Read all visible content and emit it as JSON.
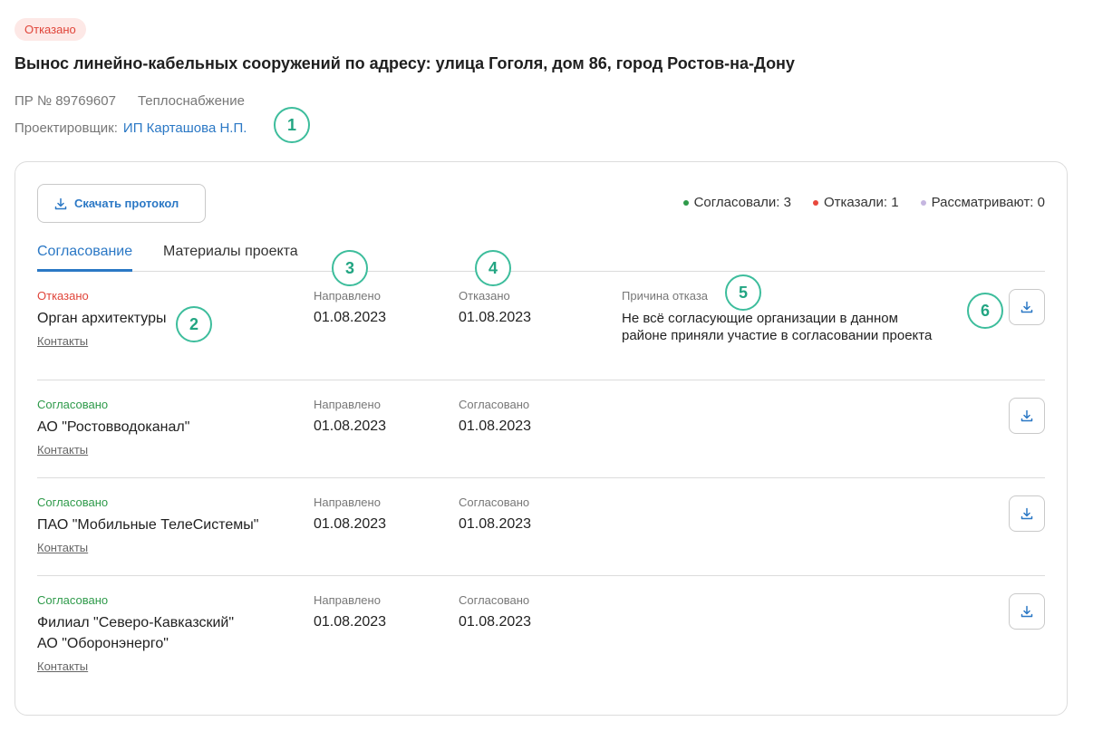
{
  "header": {
    "status_label": "Отказано",
    "title": "Вынос линейно-кабельных сооружений по адресу: улица Гоголя, дом 86, город Ростов-на-Дону",
    "request_number": "ПР № 89769607",
    "category": "Теплоснабжение",
    "designer_label": "Проектировщик:",
    "designer_name": "ИП Карташова Н.П."
  },
  "toolbar": {
    "download_protocol_label": "Скачать протокол",
    "download_icon": "download-icon"
  },
  "summary": {
    "approved": "Согласовали: 3",
    "rejected": "Отказали: 1",
    "reviewing": "Рассматривают: 0",
    "colors": {
      "approved": "#2e9a4a",
      "rejected": "#e8483d",
      "reviewing": "#c5b6e0"
    }
  },
  "tabs": [
    {
      "label": "Согласование",
      "active": true
    },
    {
      "label": "Материалы проекта",
      "active": false
    }
  ],
  "annotations": [
    "1",
    "2",
    "3",
    "4",
    "5",
    "6"
  ],
  "approvals": [
    {
      "status": "Отказано",
      "status_kind": "rejected",
      "org_lines": [
        "Орган архитектуры"
      ],
      "contacts": "Контакты",
      "sent_label": "Направлено",
      "sent_date": "01.08.2023",
      "decision_label": "Отказано",
      "decision_date": "01.08.2023",
      "reason_label": "Причина отказа",
      "reason_text": "Не всё согласующие организации в данном районе приняли участие в согласовании проекта"
    },
    {
      "status": "Согласовано",
      "status_kind": "approved",
      "org_lines": [
        "АО \"Ростовводоканал\""
      ],
      "contacts": "Контакты",
      "sent_label": "Направлено",
      "sent_date": "01.08.2023",
      "decision_label": "Согласовано",
      "decision_date": "01.08.2023"
    },
    {
      "status": "Согласовано",
      "status_kind": "approved",
      "org_lines": [
        "ПАО \"Мобильные ТелеСистемы\""
      ],
      "contacts": "Контакты",
      "sent_label": "Направлено",
      "sent_date": "01.08.2023",
      "decision_label": "Согласовано",
      "decision_date": "01.08.2023"
    },
    {
      "status": "Согласовано",
      "status_kind": "approved",
      "org_lines": [
        "Филиал \"Северо-Кавказский\"",
        "АО \"Оборонэнерго\""
      ],
      "contacts": "Контакты",
      "sent_label": "Направлено",
      "sent_date": "01.08.2023",
      "decision_label": "Согласовано",
      "decision_date": "01.08.2023"
    }
  ]
}
